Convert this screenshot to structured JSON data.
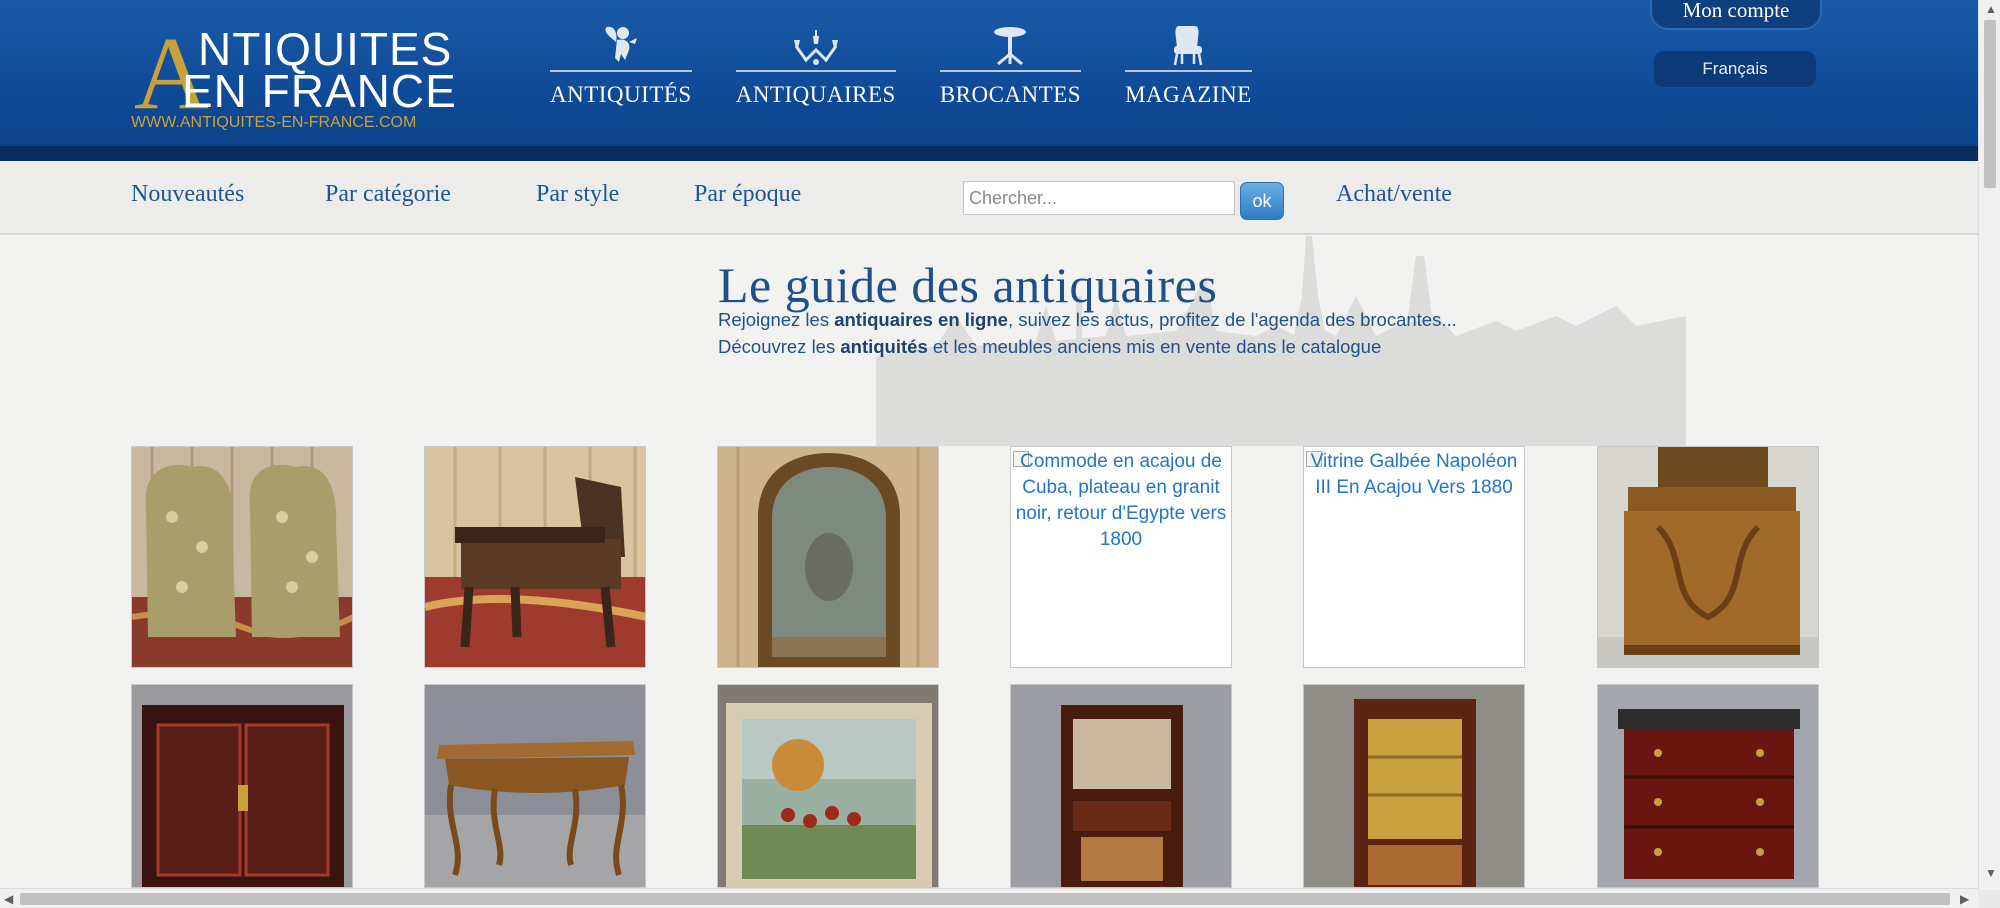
{
  "logo": {
    "letter_a": "A",
    "line1": "NTIQUITES",
    "line2": "EN FRANCE",
    "url": "WWW.ANTIQUITES-EN-FRANCE.COM"
  },
  "top_nav": [
    {
      "label": "ANTIQUITÉS",
      "icon": "cherub-icon"
    },
    {
      "label": "ANTIQUAIRES",
      "icon": "chandelier-icon"
    },
    {
      "label": "BROCANTES",
      "icon": "pedestal-table-icon"
    },
    {
      "label": "MAGAZINE",
      "icon": "armchair-icon"
    }
  ],
  "account": {
    "label": "Mon compte"
  },
  "language": {
    "label": "Français"
  },
  "sub_nav": {
    "links": [
      "Nouveautés",
      "Par catégorie",
      "Par style",
      "Par époque"
    ],
    "search_placeholder": "Chercher...",
    "search_button": "ok",
    "achat_vente": "Achat/vente"
  },
  "hero": {
    "title": "Le guide des antiquaires",
    "line1_pre": "Rejoignez les ",
    "line1_bold": "antiquaires en ligne",
    "line1_post": ", suivez les actus, profitez de l'agenda des brocantes...",
    "line2_pre": "Découvrez les ",
    "line2_bold": "antiquités",
    "line2_post": " et les meubles anciens mis en vente dans le catalogue"
  },
  "products_row1": [
    {
      "kind": "image",
      "subject": "pair of upholstered slipper chairs"
    },
    {
      "kind": "image",
      "subject": "leather armchair"
    },
    {
      "kind": "image",
      "subject": "arched gilt mirror"
    },
    {
      "kind": "broken",
      "alt": "Commode en acajou de Cuba, plateau en granit noir, retour d'Egypte vers 1800"
    },
    {
      "kind": "broken",
      "alt": "Vitrine Galbée Napoléon III En Acajou Vers 1880"
    },
    {
      "kind": "image",
      "subject": "art nouveau walnut cabinet"
    }
  ],
  "products_row2": [
    {
      "kind": "image",
      "subject": "lacquered chinese cabinet"
    },
    {
      "kind": "image",
      "subject": "louis xv style table"
    },
    {
      "kind": "image",
      "subject": "framed hunting painting"
    },
    {
      "kind": "image",
      "subject": "mahogany bar cabinet"
    },
    {
      "kind": "image",
      "subject": "glazed display cabinet"
    },
    {
      "kind": "image",
      "subject": "mahogany chest of drawers"
    }
  ],
  "colors": {
    "header_blue": "#0f4b98",
    "gold": "#c9a13b",
    "link_blue": "#1f5597",
    "alt_text_blue": "#2476c2"
  }
}
